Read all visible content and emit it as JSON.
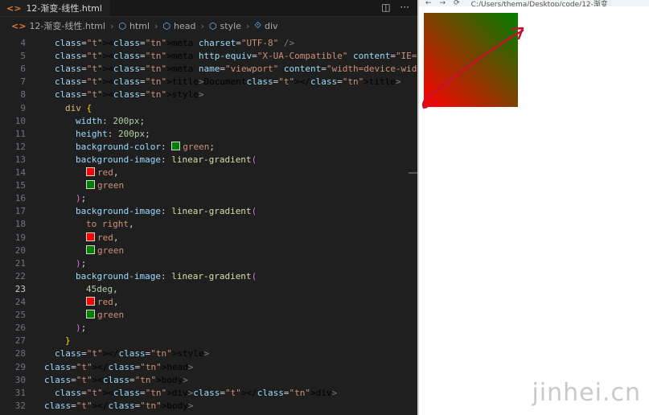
{
  "tab": {
    "icon": "html-icon",
    "label": "12-渐变-线性.html"
  },
  "tab_actions": [
    {
      "icon": "split-editor-icon",
      "glyph": "◫"
    },
    {
      "icon": "more-icon",
      "glyph": "···"
    }
  ],
  "breadcrumb": {
    "file": "12-渐变-线性.html",
    "items": [
      "html",
      "head",
      "style",
      "div"
    ]
  },
  "code_lines": [
    {
      "n": "4",
      "text": "<meta charset=\"UTF-8\" />"
    },
    {
      "n": "5",
      "text": "<meta http-equiv=\"X-UA-Compatible\" content=\"IE=edge\" />"
    },
    {
      "n": "6",
      "text": "<meta name=\"viewport\" content=\"width=device-width, initial-scale=1.0\" />"
    },
    {
      "n": "7",
      "text": "<title>Document</title>"
    },
    {
      "n": "8",
      "text": "<style>"
    },
    {
      "n": "9",
      "text": "div {"
    },
    {
      "n": "10",
      "text": "width: 200px;"
    },
    {
      "n": "11",
      "text": "height: 200px;"
    },
    {
      "n": "12",
      "text": "background-color: green;"
    },
    {
      "n": "13",
      "text": "background-image: linear-gradient("
    },
    {
      "n": "14",
      "text": "red,"
    },
    {
      "n": "15",
      "text": "green"
    },
    {
      "n": "16",
      "text": ");"
    },
    {
      "n": "17",
      "text": "background-image: linear-gradient("
    },
    {
      "n": "18",
      "text": "to right,"
    },
    {
      "n": "19",
      "text": "red,"
    },
    {
      "n": "20",
      "text": "green"
    },
    {
      "n": "21",
      "text": ");"
    },
    {
      "n": "22",
      "text": "background-image: linear-gradient("
    },
    {
      "n": "23",
      "text": "45deg,"
    },
    {
      "n": "24",
      "text": "red,"
    },
    {
      "n": "25",
      "text": "green"
    },
    {
      "n": "26",
      "text": ");"
    },
    {
      "n": "27",
      "text": "}"
    },
    {
      "n": "28",
      "text": "</style>"
    },
    {
      "n": "29",
      "text": "</head>"
    },
    {
      "n": "30",
      "text": "<body>"
    },
    {
      "n": "31",
      "text": "<div></div>"
    },
    {
      "n": "32",
      "text": "</body>"
    }
  ],
  "active_line": "23",
  "browser": {
    "url": "C:/Users/thema/Desktop/code/12-渐变"
  },
  "preview": {
    "background_color": "green",
    "gradient": [
      "45deg",
      "red",
      "green"
    ]
  },
  "watermark": "jinhei.cn",
  "colors": {
    "editor_bg": "#1f1f1f",
    "red": "#ff0000",
    "green": "#008000",
    "annotation": "#c8102e"
  }
}
